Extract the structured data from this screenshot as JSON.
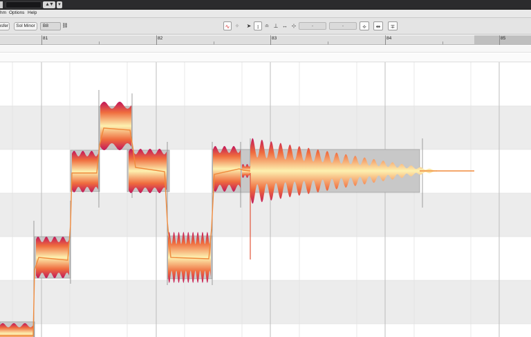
{
  "window": {
    "app": "Melodyne-style pitch editor"
  },
  "menu": {
    "items": [
      "hm",
      "Options",
      "Help"
    ]
  },
  "toolbar": {
    "transfer_label": "nsfer",
    "scale_label": "Sol Minor",
    "pitch_value": "B8",
    "field1": "-",
    "field2": "-"
  },
  "ruler": {
    "bars": [
      "81",
      "82",
      "83",
      "84",
      "85"
    ]
  },
  "colors": {
    "blob_dark": "#c2185b",
    "blob_mid": "#ef6c3e",
    "blob_light": "#fdf1b0",
    "pitch_line": "#f08a3c",
    "lane_shade": "#ececec",
    "note_box": "#c8c8c8"
  },
  "icons": [
    "link-icon",
    "pitch-drift-icon",
    "pointer-tool-icon",
    "pitch-tool-icon",
    "formant-tool-icon",
    "amplitude-tool-icon",
    "timing-tool-icon",
    "separation-tool-icon",
    "quantize-pitch-icon",
    "quantize-time-icon",
    "center-icon"
  ]
}
